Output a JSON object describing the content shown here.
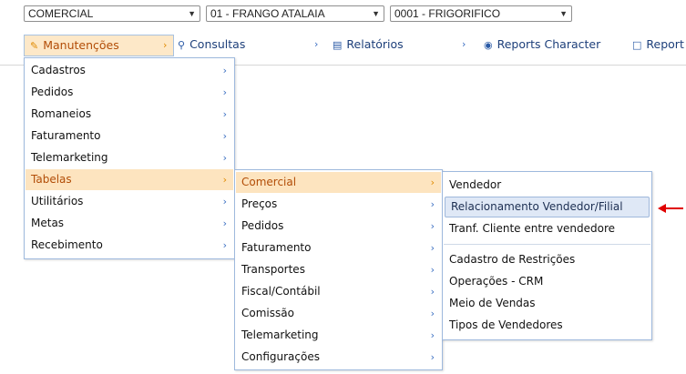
{
  "selects": {
    "company": "COMERCIAL",
    "branch": "01 - FRANGO ATALAIA",
    "unit": "0001 - FRIGORIFICO"
  },
  "menubar": [
    {
      "label": "Manutenções",
      "icon": "wrench-icon"
    },
    {
      "label": "Consultas",
      "icon": "search-icon"
    },
    {
      "label": "Relatórios",
      "icon": "report-icon"
    },
    {
      "label": "Reports Character",
      "icon": "reports-character-icon"
    },
    {
      "label": "Report",
      "icon": "document-icon"
    }
  ],
  "menu_level1": [
    "Cadastros",
    "Pedidos",
    "Romaneios",
    "Faturamento",
    "Telemarketing",
    "Tabelas",
    "Utilitários",
    "Metas",
    "Recebimento"
  ],
  "menu_level2": [
    "Comercial",
    "Preços",
    "Pedidos",
    "Faturamento",
    "Transportes",
    "Fiscal/Contábil",
    "Comissão",
    "Telemarketing",
    "Configurações"
  ],
  "menu_level3": [
    "Vendedor",
    "Relacionamento Vendedor/Filial",
    "Tranf. Cliente entre vendedore",
    "Cadastro de Restrições",
    "Operações - CRM",
    "Meio de Vendas",
    "Tipos de Vendedores"
  ],
  "colors": {
    "highlight_bg": "#fde4bf",
    "highlight_text": "#b24d07",
    "selected_bg": "#dfe8f6",
    "annotation_arrow": "#e00000"
  }
}
